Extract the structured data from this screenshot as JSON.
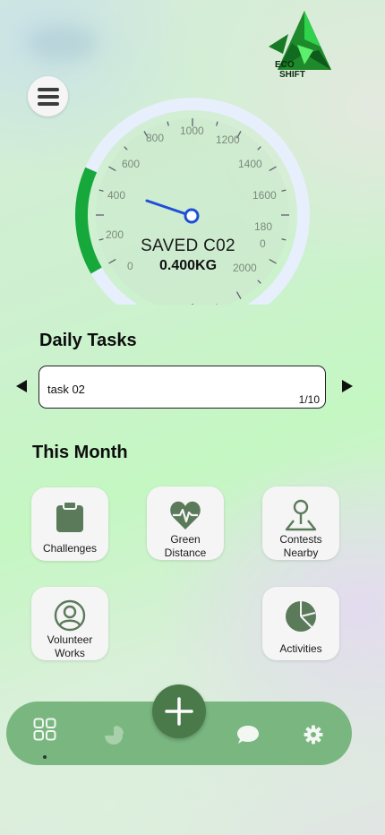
{
  "app": {
    "logo_line1": "ECO",
    "logo_line2": "SHIFT"
  },
  "header": {
    "menu_icon": "hamburger-menu-icon"
  },
  "gauge": {
    "title": "SAVED C02",
    "value": "0.400KG",
    "outer_ticks": [
      "800",
      "1000",
      "1200",
      "600",
      "1400",
      "400",
      "1600",
      "200",
      "0",
      "2000"
    ],
    "inner_ticks": [
      "180",
      "0"
    ],
    "progress_fraction": 0.18,
    "accent": "#16a83a",
    "needle_color": "#1f4fd6"
  },
  "daily_tasks": {
    "title": "Daily Tasks",
    "task_name": "task 02",
    "counter": "1/10",
    "prev_icon": "arrow-left-icon",
    "next_icon": "arrow-right-icon"
  },
  "this_month": {
    "title": "This Month",
    "tiles": [
      {
        "label": "Challenges",
        "icon": "clipboard-icon"
      },
      {
        "label": "Green Distance",
        "icon": "heartbeat-icon"
      },
      {
        "label": "Contests Nearby",
        "icon": "map-pin-icon"
      },
      {
        "label": "Volunteer Works",
        "icon": "user-icon"
      },
      {
        "label": "Activities",
        "icon": "pie-chart-icon"
      }
    ],
    "icon_color": "#5b7a5a"
  },
  "bottom_nav": {
    "items": [
      "dashboard-icon",
      "pie-chart-icon",
      "chat-icon",
      "settings-icon"
    ],
    "fab_icon": "plus-icon",
    "active": "dashboard-icon",
    "bar_color": "#7ab780",
    "fab_color": "#4a7a49"
  }
}
